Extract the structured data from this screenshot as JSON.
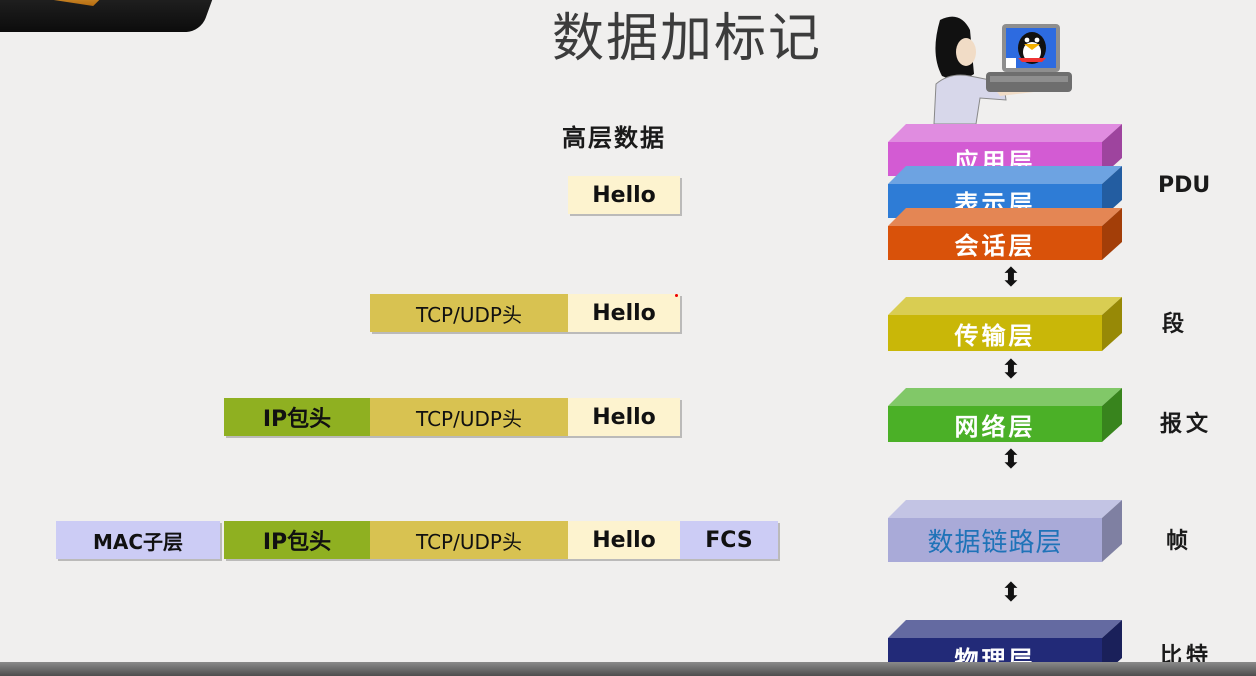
{
  "title": "数据加标记",
  "high_level_label": "高层数据",
  "encap_rows": [
    {
      "hello": "Hello"
    },
    {
      "tcp": "TCP/UDP头",
      "hello": "Hello"
    },
    {
      "ip": "IP包头",
      "tcp": "TCP/UDP头",
      "hello": "Hello"
    },
    {
      "mac": "MAC子层",
      "ip": "IP包头",
      "tcp": "TCP/UDP头",
      "hello": "Hello",
      "fcs": "FCS"
    }
  ],
  "layers": [
    {
      "name": "应用层",
      "color": "#d35bd3"
    },
    {
      "name": "表示层",
      "color": "#2e7cd6"
    },
    {
      "name": "会话层",
      "color": "#d9520a"
    },
    {
      "name": "传输层",
      "color": "#c9b708"
    },
    {
      "name": "网络层",
      "color": "#4bb027"
    },
    {
      "name": "数据链路层",
      "color": "#a9aad8"
    },
    {
      "name": "物理层",
      "color": "#222a78"
    }
  ],
  "pdu_labels": [
    "PDU",
    "段",
    "报文",
    "帧",
    "比特"
  ],
  "arrow_glyph": "⬍",
  "icons": [
    "logo-icon",
    "person-at-computer-icon",
    "penguin-icon"
  ]
}
